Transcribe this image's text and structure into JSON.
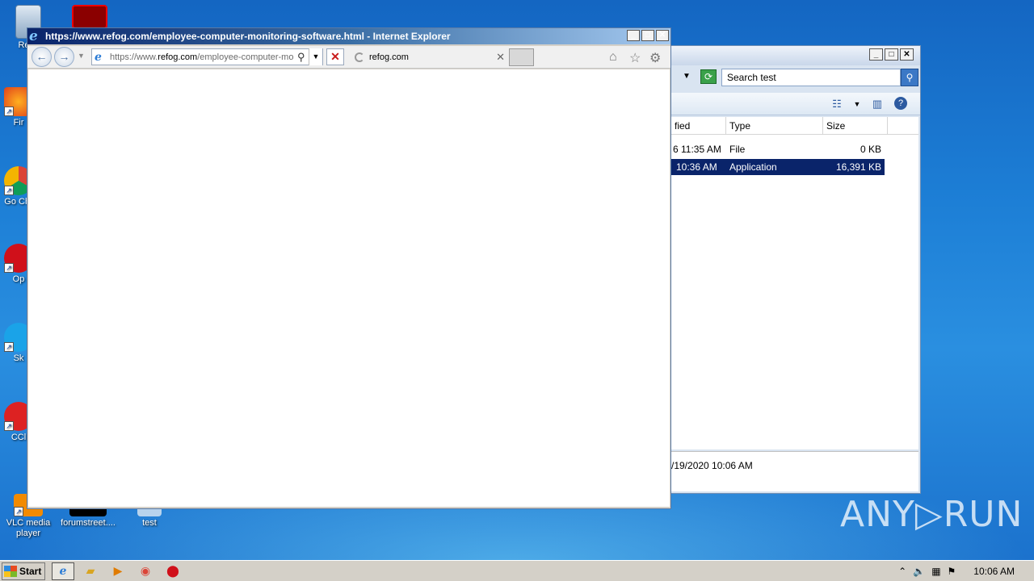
{
  "desktop": {
    "icons": [
      {
        "label": "Recy",
        "name": "recycle-bin"
      },
      {
        "label": "Fir",
        "name": "firefox"
      },
      {
        "label": "Go Chr",
        "name": "google-chrome"
      },
      {
        "label": "Op",
        "name": "opera"
      },
      {
        "label": "Sk",
        "name": "skype"
      },
      {
        "label": "CCl",
        "name": "ccleaner"
      },
      {
        "label": "VLC media player",
        "name": "vlc"
      },
      {
        "label": "forumstreet....",
        "name": "forumstreet"
      },
      {
        "label": "test",
        "name": "test-folder"
      }
    ]
  },
  "explorer": {
    "search_placeholder": "Search test",
    "columns": [
      "fied",
      "Type",
      "Size"
    ],
    "rows": [
      {
        "modified": "6 11:35 AM",
        "type": "File",
        "size": "0 KB",
        "selected": false
      },
      {
        "modified": "10:36 AM",
        "type": "Application",
        "size": "16,391 KB",
        "selected": true
      }
    ],
    "details_date": "/19/2020 10:06 AM"
  },
  "ie": {
    "title": "https://www.refog.com/employee-computer-monitoring-software.html - Internet Explorer",
    "address_prefix": "https://www.",
    "address_domain": "refog.com",
    "address_rest": "/employee-computer-mo",
    "tab_label": "refog.com"
  },
  "watermark": "ANY▷RUN",
  "taskbar": {
    "start_label": "Start",
    "clock": "10:06 AM"
  }
}
